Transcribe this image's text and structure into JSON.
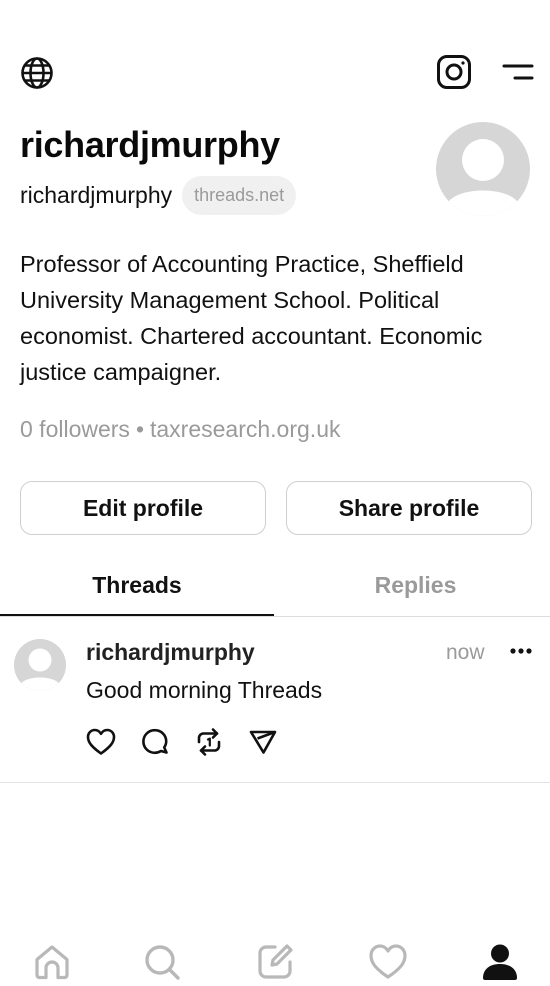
{
  "header": {
    "globe_icon": "globe-icon",
    "instagram_icon": "instagram-icon",
    "menu_icon": "menu-icon"
  },
  "profile": {
    "name": "richardjmurphy",
    "handle": "richardjmurphy",
    "domain_badge": "threads.net",
    "bio": "Professor of Accounting Practice, Sheffield University Management School. Political economist. Chartered accountant. Economic justice campaigner.",
    "followers": "0 followers",
    "separator": "•",
    "link": "taxresearch.org.uk"
  },
  "actions": {
    "edit_label": "Edit profile",
    "share_label": "Share profile"
  },
  "tabs": [
    {
      "label": "Threads",
      "active": true
    },
    {
      "label": "Replies",
      "active": false
    }
  ],
  "posts": [
    {
      "author": "richardjmurphy",
      "time": "now",
      "text": "Good morning Threads",
      "actions": [
        "heart-icon",
        "comment-icon",
        "repost-icon",
        "send-icon"
      ]
    }
  ],
  "bottom_nav": [
    "home-icon",
    "search-icon",
    "compose-icon",
    "heart-icon",
    "profile-icon"
  ],
  "colors": {
    "text": "#111111",
    "muted": "#9a9a9a",
    "border": "#cfcfcf",
    "avatar_bg": "#d6d6d6",
    "nav_inactive": "#b8b8b8"
  }
}
